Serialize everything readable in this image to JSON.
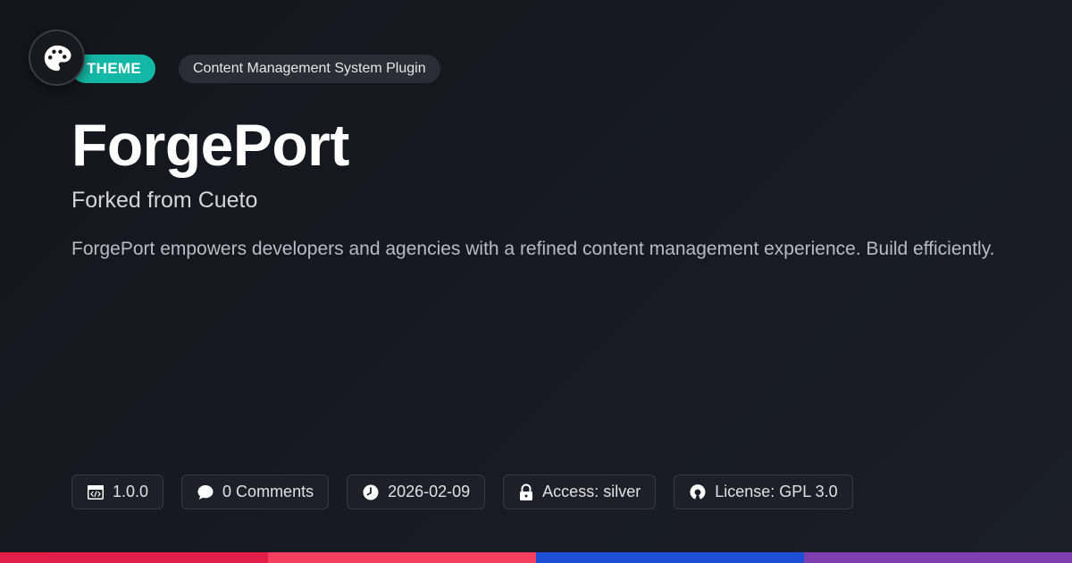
{
  "header": {
    "logo_icon": "palette-icon",
    "type_badge": "THEME",
    "category_badge": "Content Management System Plugin"
  },
  "main": {
    "title": "ForgePort",
    "subtitle": "Forked from Cueto",
    "description": "ForgePort empowers developers and agencies with a refined content management experience. Build efficiently."
  },
  "meta": [
    {
      "icon": "code-window-icon",
      "label": "1.0.0"
    },
    {
      "icon": "comment-icon",
      "label": "0 Comments"
    },
    {
      "icon": "clock-icon",
      "label": "2026-02-09"
    },
    {
      "icon": "lock-icon",
      "label": "Access: silver"
    },
    {
      "icon": "open-source-icon",
      "label": "License: GPL 3.0"
    }
  ],
  "colors": {
    "accent": "#14b8a6",
    "background": "#16181f",
    "bar": [
      "#e11d48",
      "#f43f5e",
      "#1d4ed8",
      "#7e3fae"
    ]
  }
}
